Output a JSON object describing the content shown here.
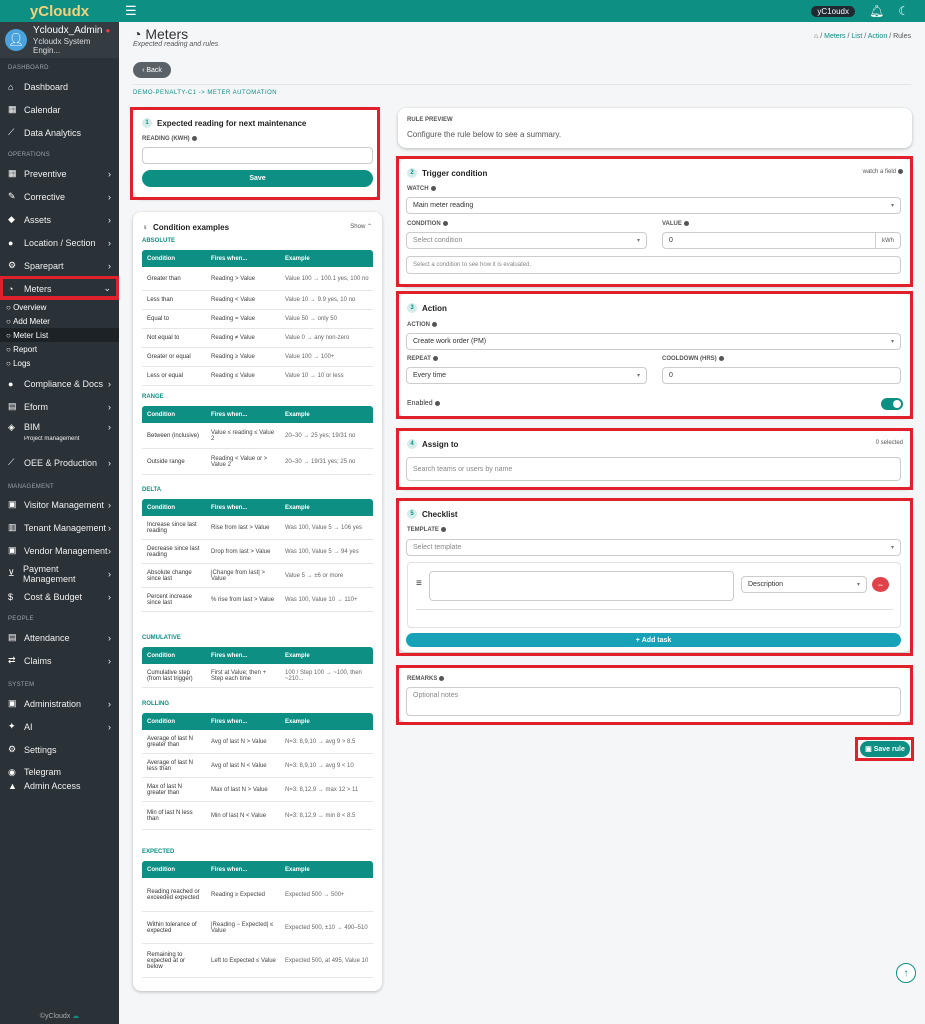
{
  "topbar": {
    "brand": "yCloudx",
    "badge": "yC1oudx"
  },
  "sidebar": {
    "user_name": "Ycloudx_Admin",
    "user_role": "Ycloudx System Engin...",
    "sections": {
      "dashboard": "DASHBOARD",
      "operations": "OPERATIONS",
      "management": "MANAGEMENT",
      "people": "PEOPLE",
      "system": "SYSTEM"
    },
    "items": {
      "dashboard": "Dashboard",
      "calendar": "Calendar",
      "analytics": "Data Analytics",
      "preventive": "Preventive",
      "corrective": "Corrective",
      "assets": "Assets",
      "location": "Location / Section",
      "sparepart": "Sparepart",
      "meters": "Meters",
      "compliance": "Compliance & Docs",
      "eform": "Eform",
      "bim": "BIM",
      "project": "Project management",
      "oee": "OEE & Production",
      "visitor": "Visitor Management",
      "tenant": "Tenant Management",
      "vendor": "Vendor Management",
      "payment": "Payment Management",
      "cost": "Cost & Budget",
      "attendance": "Attendance",
      "claims": "Claims",
      "administration": "Administration",
      "ai": "AI",
      "settings": "Settings",
      "telegram": "Telegram",
      "admin_access": "Admin Access"
    },
    "meters_sub": {
      "overview": "Overview",
      "add": "Add Meter",
      "list": "Meter List",
      "report": "Report",
      "logs": "Logs"
    },
    "footer": "©yCloudx"
  },
  "header": {
    "title": "Meters",
    "subtitle": "Expected reading and rules",
    "breadcrumb": {
      "sep": "/",
      "meters": "Meters",
      "list": "List",
      "action": "Action",
      "rules": "Rules"
    },
    "back": "Back",
    "automation": "DEMO-PENALTY-C1 -> METER AUTOMATION"
  },
  "expected": {
    "step": "1",
    "title": "Expected reading for next maintenance",
    "label": "READING (KWH)",
    "value": "",
    "save": "Save"
  },
  "preview": {
    "label": "RULE PREVIEW",
    "text": "Configure the rule below to see a summary."
  },
  "trigger": {
    "step": "2",
    "title": "Trigger condition",
    "watch_link": "watch a field",
    "watch_label": "WATCH",
    "watch_value": "Main meter reading",
    "condition_label": "CONDITION",
    "condition_placeholder": "Select condition",
    "value_label": "VALUE",
    "value": "0",
    "unit": "kWh",
    "hint": "Select a condition to see how it is evaluated."
  },
  "action": {
    "step": "3",
    "title": "Action",
    "action_label": "ACTION",
    "action_value": "Create work order (PM)",
    "repeat_label": "REPEAT",
    "repeat_value": "Every time",
    "cooldown_label": "COOLDOWN (HRS)",
    "cooldown_value": "0",
    "enabled_label": "Enabled",
    "enabled": true
  },
  "assign": {
    "step": "4",
    "title": "Assign to",
    "count": "0 selected",
    "placeholder": "Search teams or users by name"
  },
  "checklist": {
    "step": "5",
    "title": "Checklist",
    "template_label": "TEMPLATE",
    "template_placeholder": "Select template",
    "task_type": "Description",
    "add_task": "Add task"
  },
  "remarks": {
    "label": "REMARKS",
    "placeholder": "Optional notes"
  },
  "save_rule": "Save rule",
  "examples": {
    "title": "Condition examples",
    "toggle": "Show",
    "headers": [
      "Condition",
      "Fires when...",
      "Example"
    ],
    "groups": [
      {
        "name": "ABSOLUTE",
        "rows": [
          [
            "Greater than",
            "Reading > Value",
            "Value 100 → 100.1 yes, 100 no"
          ],
          [
            "Less than",
            "Reading < Value",
            "Value 10 → 9.9 yes, 10 no"
          ],
          [
            "Equal to",
            "Reading = Value",
            "Value 50 → only 50"
          ],
          [
            "Not equal to",
            "Reading ≠ Value",
            "Value 0 → any non-zero"
          ],
          [
            "Greater or equal",
            "Reading ≥ Value",
            "Value 100 → 100+"
          ],
          [
            "Less or equal",
            "Reading ≤ Value",
            "Value 10 → 10 or less"
          ]
        ]
      },
      {
        "name": "RANGE",
        "rows": [
          [
            "Between (inclusive)",
            "Value ≤ reading ≤ Value 2",
            "20–30 → 25 yes; 19/31 no"
          ],
          [
            "Outside range",
            "Reading < Value or > Value 2",
            "20–30 → 19/31 yes; 25 no"
          ]
        ]
      },
      {
        "name": "DELTA",
        "rows": [
          [
            "Increase since last reading",
            "Rise from last > Value",
            "Was 100, Value 5 → 106 yes"
          ],
          [
            "Decrease since last reading",
            "Drop from last > Value",
            "Was 100, Value 5 → 94 yes"
          ],
          [
            "Absolute change since last",
            "|Change from last| > Value",
            "Value 5 → ±6 or more"
          ],
          [
            "Percent increase since last",
            "% rise from last > Value",
            "Was 100, Value 10 → 110+"
          ]
        ]
      },
      {
        "name": "CUMULATIVE",
        "rows": [
          [
            "Cumulative step (from last trigger)",
            "First at Value; then + Step each time",
            "100 / Step 100 → ~100, then ~210..."
          ]
        ]
      },
      {
        "name": "ROLLING",
        "rows": [
          [
            "Average of last N greater than",
            "Avg of last N > Value",
            "N=3: 8,9,10 → avg 9 > 8.5"
          ],
          [
            "Average of last N less than",
            "Avg of last N < Value",
            "N=3: 8,9,10 → avg 9 < 10"
          ],
          [
            "Max of last N greater than",
            "Max of last N > Value",
            "N=3: 8,12,9 → max 12 > 11"
          ],
          [
            "Min of last N less than",
            "Min of last N < Value",
            "N=3: 8,12,9 → min 8 < 8.5"
          ]
        ]
      },
      {
        "name": "EXPECTED",
        "rows": [
          [
            "Reading reached or exceeded expected",
            "Reading ≥ Expected",
            "Expected 500 → 500+"
          ],
          [
            "Within tolerance of expected",
            "|Reading − Expected| ≤ Value",
            "Expected 500, ±10 → 490–510"
          ],
          [
            "Remaining to expected at or below",
            "Left to Expected ≤ Value",
            "Expected 500, at 495, Value 10"
          ]
        ]
      }
    ]
  }
}
